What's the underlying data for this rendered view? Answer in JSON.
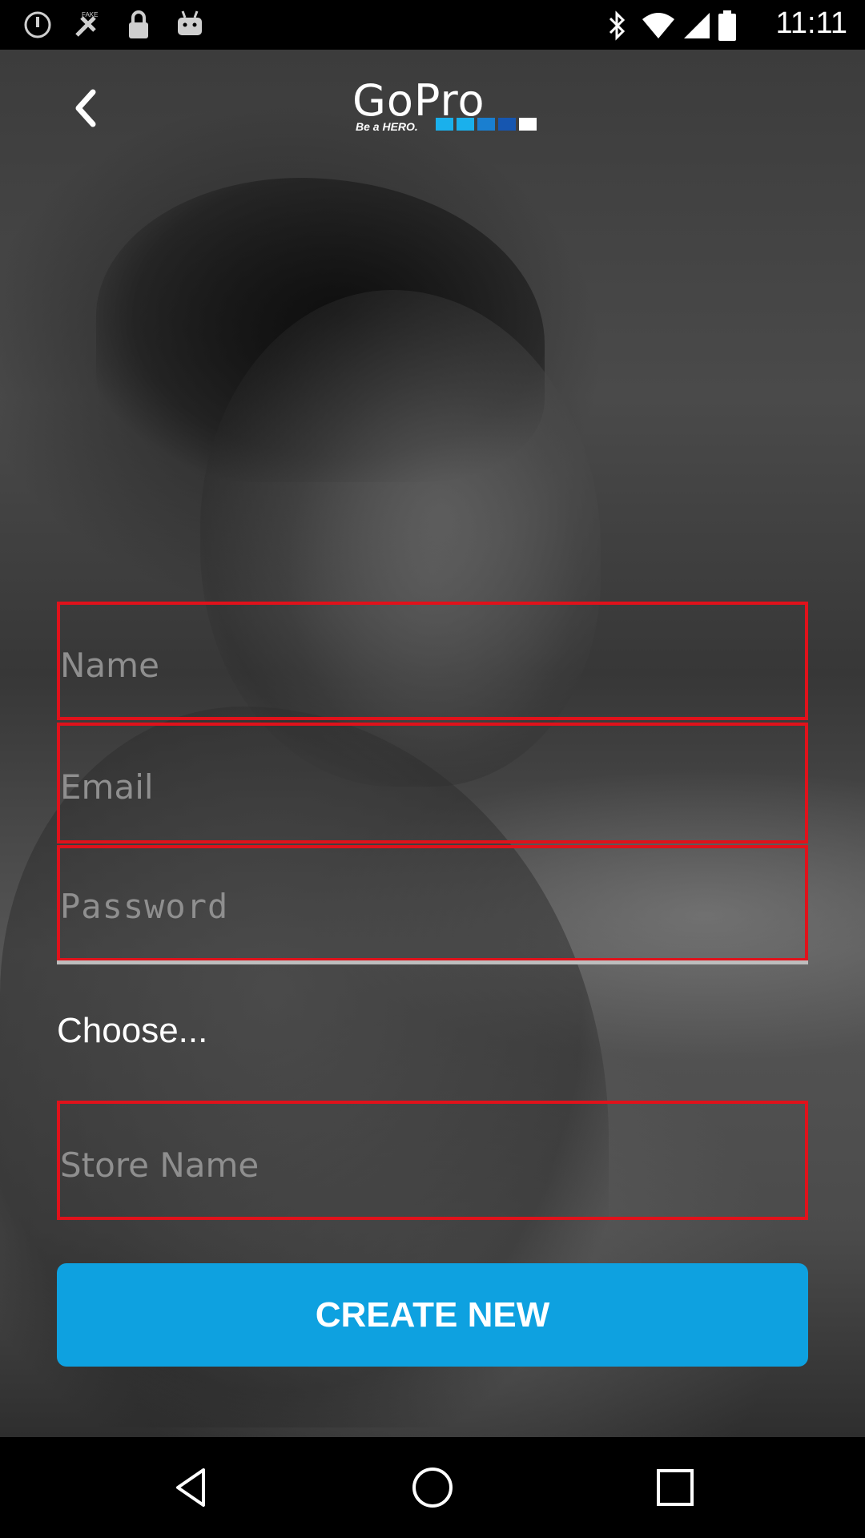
{
  "status_bar": {
    "time": "11:11",
    "icons": [
      "alarm-icon",
      "fake-gps-icon",
      "lock-icon",
      "android-icon",
      "bluetooth-icon",
      "wifi-icon",
      "signal-icon",
      "battery-icon"
    ]
  },
  "header": {
    "back_icon": "chevron-left-icon",
    "logo_text": "GoPro",
    "logo_tagline": "Be a HERO.",
    "logo_colors": [
      "#1ab0ec",
      "#1ab0ec",
      "#1a7fd0",
      "#1656b0",
      "#ffffff"
    ]
  },
  "form": {
    "name_placeholder": "Name",
    "email_placeholder": "Email",
    "password_placeholder": "Password",
    "choose_label": "Choose...",
    "store_placeholder": "Store Name",
    "create_label": "CREATE NEW"
  },
  "colors": {
    "field_border": "#e0121b",
    "button_bg": "#0ea1e0",
    "placeholder": "#8f8f8f"
  },
  "nav_bar": {
    "icons": [
      "back-triangle-icon",
      "home-circle-icon",
      "recents-square-icon"
    ]
  }
}
